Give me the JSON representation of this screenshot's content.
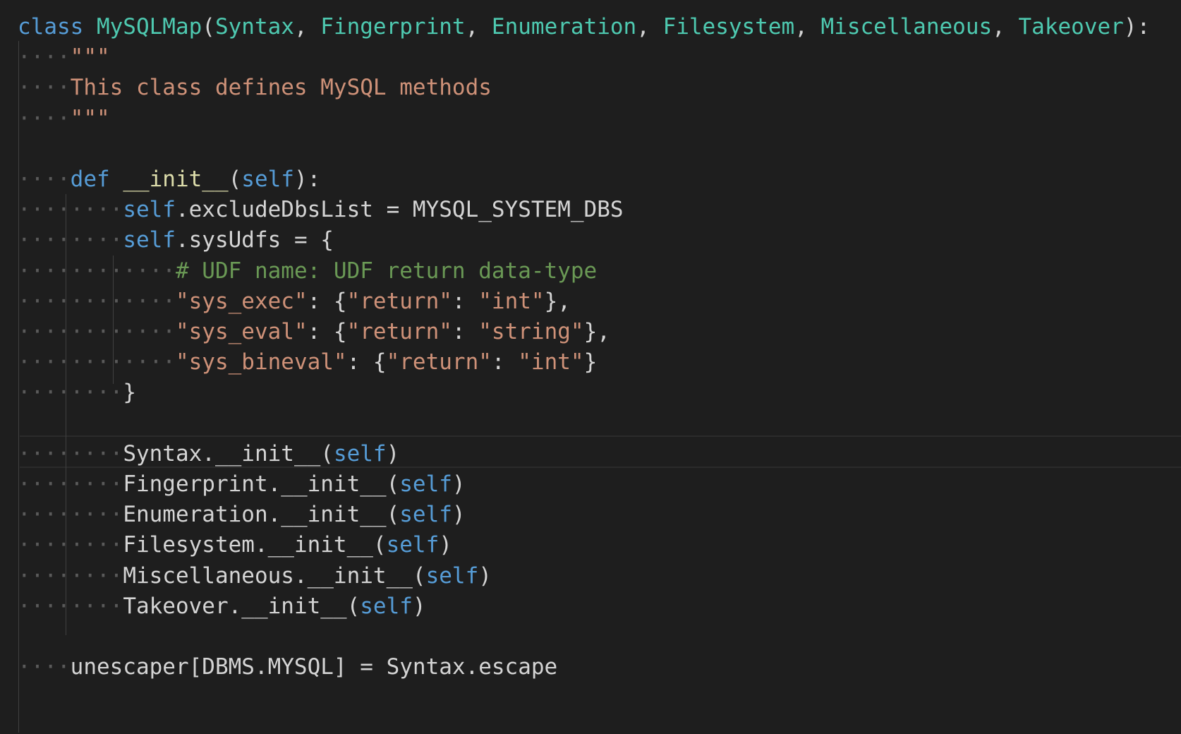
{
  "editor": {
    "lines": [
      [
        {
          "t": "class ",
          "c": "kw"
        },
        {
          "t": "MySQLMap",
          "c": "cls"
        },
        {
          "t": "(",
          "c": "plain"
        },
        {
          "t": "Syntax",
          "c": "cls"
        },
        {
          "t": ", ",
          "c": "plain"
        },
        {
          "t": "Fingerprint",
          "c": "cls"
        },
        {
          "t": ", ",
          "c": "plain"
        },
        {
          "t": "Enumeration",
          "c": "cls"
        },
        {
          "t": ", ",
          "c": "plain"
        },
        {
          "t": "Filesystem",
          "c": "cls"
        },
        {
          "t": ", ",
          "c": "plain"
        },
        {
          "t": "Miscellaneous",
          "c": "cls"
        },
        {
          "t": ", ",
          "c": "plain"
        },
        {
          "t": "Takeover",
          "c": "cls"
        },
        {
          "t": "):",
          "c": "plain"
        }
      ],
      [
        {
          "t": "····",
          "c": "ws"
        },
        {
          "t": "\"\"\"",
          "c": "str"
        }
      ],
      [
        {
          "t": "····",
          "c": "ws"
        },
        {
          "t": "This class defines MySQL methods",
          "c": "str"
        }
      ],
      [
        {
          "t": "····",
          "c": "ws"
        },
        {
          "t": "\"\"\"",
          "c": "str"
        }
      ],
      [],
      [
        {
          "t": "····",
          "c": "ws"
        },
        {
          "t": "def ",
          "c": "kw"
        },
        {
          "t": "__init__",
          "c": "fn"
        },
        {
          "t": "(",
          "c": "plain"
        },
        {
          "t": "self",
          "c": "slf"
        },
        {
          "t": "):",
          "c": "plain"
        }
      ],
      [
        {
          "t": "········",
          "c": "ws"
        },
        {
          "t": "self",
          "c": "slf"
        },
        {
          "t": ".excludeDbsList = MYSQL_SYSTEM_DBS",
          "c": "plain"
        }
      ],
      [
        {
          "t": "········",
          "c": "ws"
        },
        {
          "t": "self",
          "c": "slf"
        },
        {
          "t": ".sysUdfs = {",
          "c": "plain"
        }
      ],
      [
        {
          "t": "············",
          "c": "ws"
        },
        {
          "t": "# UDF name: UDF return data-type",
          "c": "cmt"
        }
      ],
      [
        {
          "t": "············",
          "c": "ws"
        },
        {
          "t": "\"sys_exec\"",
          "c": "str"
        },
        {
          "t": ": {",
          "c": "plain"
        },
        {
          "t": "\"return\"",
          "c": "str"
        },
        {
          "t": ": ",
          "c": "plain"
        },
        {
          "t": "\"int\"",
          "c": "str"
        },
        {
          "t": "},",
          "c": "plain"
        }
      ],
      [
        {
          "t": "············",
          "c": "ws"
        },
        {
          "t": "\"sys_eval\"",
          "c": "str"
        },
        {
          "t": ": {",
          "c": "plain"
        },
        {
          "t": "\"return\"",
          "c": "str"
        },
        {
          "t": ": ",
          "c": "plain"
        },
        {
          "t": "\"string\"",
          "c": "str"
        },
        {
          "t": "},",
          "c": "plain"
        }
      ],
      [
        {
          "t": "············",
          "c": "ws"
        },
        {
          "t": "\"sys_bineval\"",
          "c": "str"
        },
        {
          "t": ": {",
          "c": "plain"
        },
        {
          "t": "\"return\"",
          "c": "str"
        },
        {
          "t": ": ",
          "c": "plain"
        },
        {
          "t": "\"int\"",
          "c": "str"
        },
        {
          "t": "}",
          "c": "plain"
        }
      ],
      [
        {
          "t": "········",
          "c": "ws"
        },
        {
          "t": "}",
          "c": "plain"
        }
      ],
      [],
      [
        {
          "t": "········",
          "c": "ws"
        },
        {
          "t": "Syntax.__init__(",
          "c": "plain"
        },
        {
          "t": "self",
          "c": "slf"
        },
        {
          "t": ")",
          "c": "plain"
        }
      ],
      [
        {
          "t": "········",
          "c": "ws"
        },
        {
          "t": "Fingerprint.__init__(",
          "c": "plain"
        },
        {
          "t": "self",
          "c": "slf"
        },
        {
          "t": ")",
          "c": "plain"
        }
      ],
      [
        {
          "t": "········",
          "c": "ws"
        },
        {
          "t": "Enumeration.__init__(",
          "c": "plain"
        },
        {
          "t": "self",
          "c": "slf"
        },
        {
          "t": ")",
          "c": "plain"
        }
      ],
      [
        {
          "t": "········",
          "c": "ws"
        },
        {
          "t": "Filesystem.__init__(",
          "c": "plain"
        },
        {
          "t": "self",
          "c": "slf"
        },
        {
          "t": ")",
          "c": "plain"
        }
      ],
      [
        {
          "t": "········",
          "c": "ws"
        },
        {
          "t": "Miscellaneous.__init__(",
          "c": "plain"
        },
        {
          "t": "self",
          "c": "slf"
        },
        {
          "t": ")",
          "c": "plain"
        }
      ],
      [
        {
          "t": "········",
          "c": "ws"
        },
        {
          "t": "Takeover.__init__(",
          "c": "plain"
        },
        {
          "t": "self",
          "c": "slf"
        },
        {
          "t": ")",
          "c": "plain"
        }
      ],
      [],
      [
        {
          "t": "····",
          "c": "ws"
        },
        {
          "t": "unescaper[DBMS.MYSQL] = Syntax.escape",
          "c": "plain"
        }
      ]
    ],
    "colors": {
      "background": "#1e1e1e",
      "keyword": "#569cd6",
      "class_name": "#4ec9b0",
      "string": "#ce9178",
      "comment": "#6a9955",
      "plain": "#d4d4d4",
      "whitespace_marker": "#5a5a5a"
    }
  }
}
